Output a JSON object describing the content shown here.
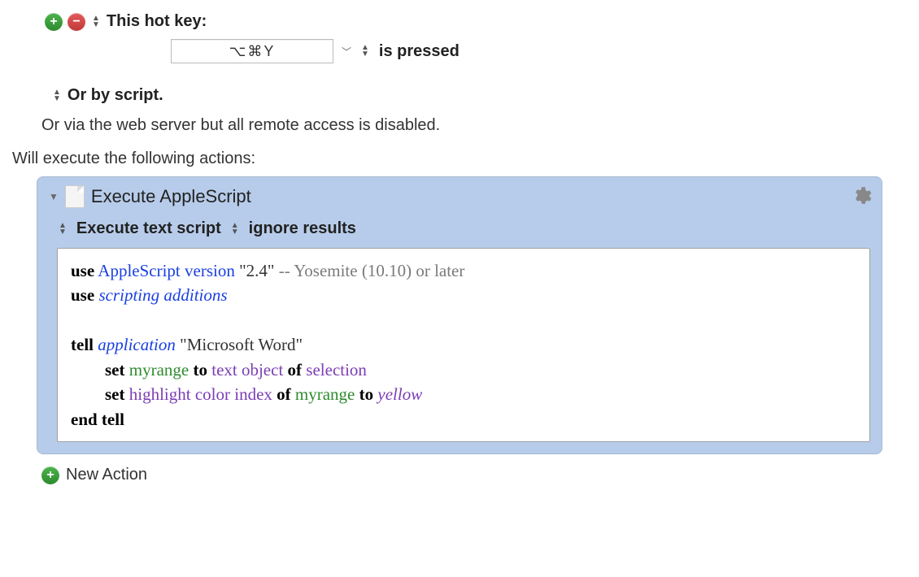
{
  "trigger": {
    "this_hot_key": "This hot key:",
    "hotkey_value": "⌥⌘Y",
    "is_pressed": "is pressed"
  },
  "or_by_script": "Or by script.",
  "remote_line": "Or via the web server but all remote access is disabled.",
  "execute_header": "Will execute the following actions:",
  "action": {
    "title": "Execute AppleScript",
    "option_execute": "Execute text script",
    "option_ignore": "ignore results",
    "code": {
      "line1": {
        "kw1": "use",
        "sp": " ",
        "w1": "AppleScript",
        "sp2": " ",
        "w2": "version",
        "sp3": " ",
        "str": "\"2.4\"",
        "rest": " -- Yosemite (10.10) or later"
      },
      "line2": {
        "kw1": "use",
        "sp": " ",
        "w1": "scripting additions"
      },
      "line3": "",
      "line4": {
        "kw1": "tell",
        "sp": " ",
        "w1": "application",
        "sp2": " ",
        "str": "\"Microsoft Word\""
      },
      "line5": {
        "indent": "        ",
        "kw1": "set",
        "sp": " ",
        "g1": "myrange",
        "sp2": " ",
        "kw2": "to",
        "sp3": " ",
        "p1": "text object",
        "sp4": " ",
        "kw3": "of",
        "sp5": " ",
        "p2": "selection"
      },
      "line6": {
        "indent": "        ",
        "kw1": "set",
        "sp": " ",
        "p1": "highlight color index",
        "sp2": " ",
        "kw2": "of",
        "sp3": " ",
        "g1": "myrange",
        "sp4": " ",
        "kw3": "to",
        "sp5": " ",
        "w1": "yellow"
      },
      "line7": {
        "kw1": "end tell"
      }
    }
  },
  "new_action": "New Action"
}
